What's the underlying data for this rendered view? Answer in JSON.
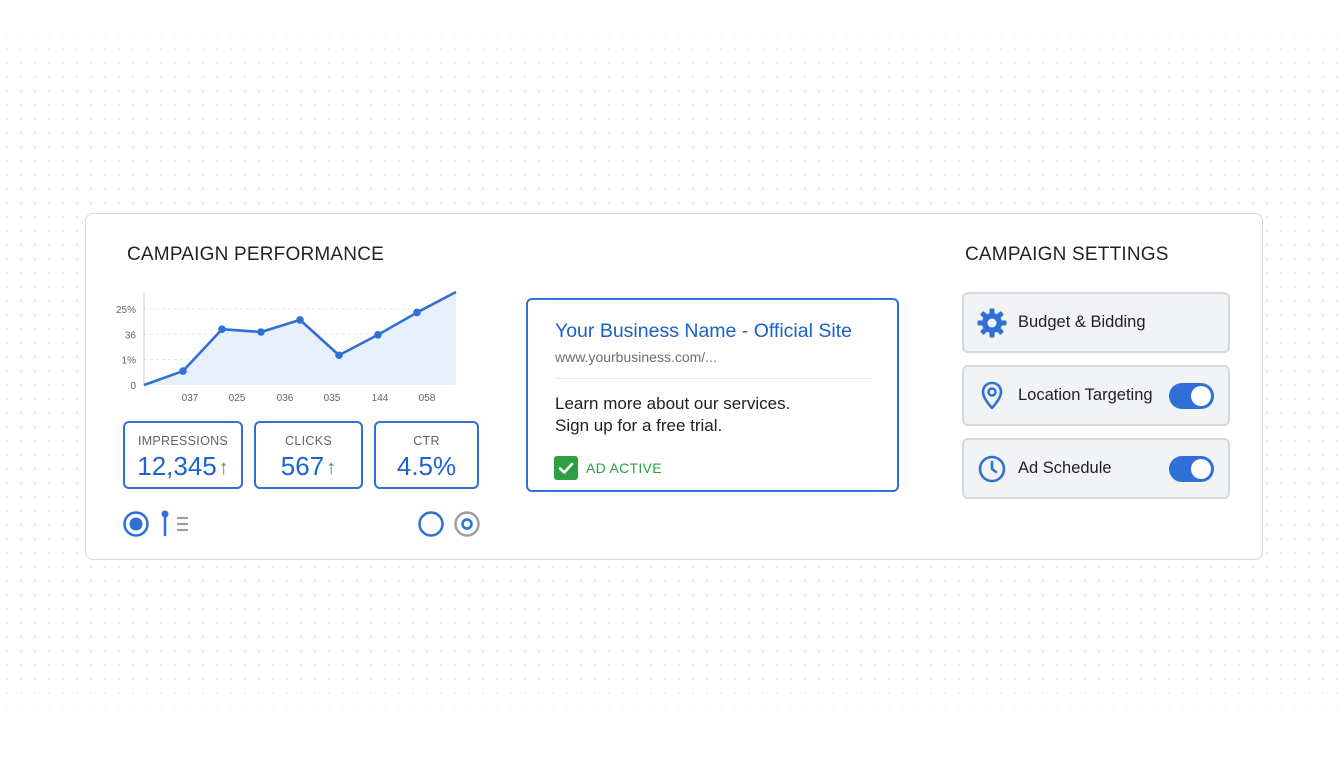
{
  "performance": {
    "title": "CAMPAIGN PERFORMANCE",
    "metrics": [
      {
        "label": "IMPRESSIONS",
        "value": "12,345",
        "trend": "up"
      },
      {
        "label": "CLICKS",
        "value": "567",
        "trend": "up"
      },
      {
        "label": "CTR",
        "value": "4.5%"
      }
    ]
  },
  "chart_data": {
    "type": "area",
    "y_tick_labels": [
      "25%",
      "36",
      "1%",
      "0"
    ],
    "x_tick_labels": [
      "037",
      "025",
      "036",
      "035",
      "144",
      "058"
    ],
    "series": [
      {
        "values": [
          0,
          15,
          60,
          57,
          70,
          32,
          54,
          78,
          100
        ]
      }
    ],
    "ylim": [
      0,
      100
    ],
    "grid": true,
    "line_color": "#2f6fd6",
    "fill_color": "#e8f0fc"
  },
  "ad_preview": {
    "headline": "Your Business Name - Official Site",
    "display_url": "www.yourbusiness.com/...",
    "description_line1": "Learn more about our services.",
    "description_line2": "Sign up for a free trial.",
    "status": "AD ACTIVE"
  },
  "settings": {
    "title": "CAMPAIGN SETTINGS",
    "items": [
      {
        "label": "Budget & Bidding",
        "icon": "gear-icon"
      },
      {
        "label": "Location Targeting",
        "icon": "location-pin-icon",
        "toggle": true
      },
      {
        "label": "Ad Schedule",
        "icon": "clock-icon",
        "toggle": true
      }
    ]
  },
  "colors": {
    "accent": "#2f6fd6",
    "success": "#2e9e43",
    "border": "#d5d8dd"
  }
}
